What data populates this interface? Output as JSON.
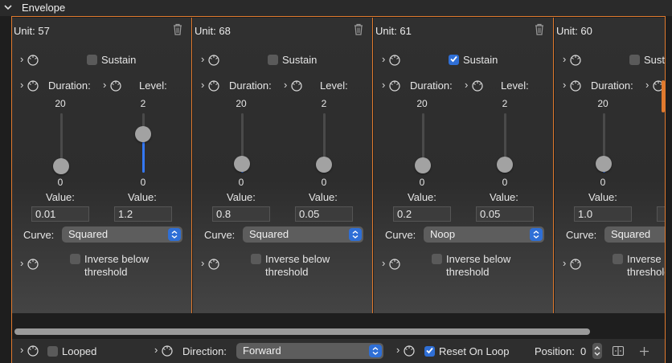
{
  "header": {
    "title": "Envelope"
  },
  "units": [
    {
      "title": "Unit: 57",
      "sustain": {
        "label": "Sustain",
        "checked": false
      },
      "duration": {
        "label": "Duration:",
        "max": "20",
        "min": "0",
        "value_label": "Value:",
        "value": "0.01",
        "level": 0.0005
      },
      "level": {
        "label": "Level:",
        "max": "2",
        "min": "0",
        "value_label": "Value:",
        "value": "1.2",
        "level": 0.6
      },
      "curve": {
        "label": "Curve:",
        "value": "Squared"
      },
      "inverse": {
        "line1": "Inverse below",
        "line2": "threshold",
        "checked": false
      }
    },
    {
      "title": "Unit: 68",
      "sustain": {
        "label": "Sustain",
        "checked": false
      },
      "duration": {
        "label": "Duration:",
        "max": "20",
        "min": "0",
        "value_label": "Value:",
        "value": "0.8",
        "level": 0.04
      },
      "level": {
        "label": "Level:",
        "max": "2",
        "min": "0",
        "value_label": "Value:",
        "value": "0.05",
        "level": 0.025
      },
      "curve": {
        "label": "Curve:",
        "value": "Squared"
      },
      "inverse": {
        "line1": "Inverse below",
        "line2": "threshold",
        "checked": false
      }
    },
    {
      "title": "Unit: 61",
      "sustain": {
        "label": "Sustain",
        "checked": true
      },
      "duration": {
        "label": "Duration:",
        "max": "20",
        "min": "0",
        "value_label": "Value:",
        "value": "0.2",
        "level": 0.01
      },
      "level": {
        "label": "Level:",
        "max": "2",
        "min": "0",
        "value_label": "Value:",
        "value": "0.05",
        "level": 0.025
      },
      "curve": {
        "label": "Curve:",
        "value": "Noop"
      },
      "inverse": {
        "line1": "Inverse below",
        "line2": "threshold",
        "checked": false
      }
    },
    {
      "title": "Unit: 60",
      "sustain": {
        "label": "Sustain",
        "checked": false
      },
      "duration": {
        "label": "Duration:",
        "max": "20",
        "min": "0",
        "value_label": "Value:",
        "value": "1.0",
        "level": 0.05
      },
      "curve": {
        "label": "Curve:",
        "value": "Squared"
      },
      "inverse": {
        "line1": "Inverse below",
        "line2": "threshold",
        "checked": false
      }
    }
  ],
  "footer": {
    "looped_label": "Looped",
    "looped_checked": false,
    "direction_label": "Direction:",
    "direction_value": "Forward",
    "reset_label": "Reset On Loop",
    "reset_checked": true,
    "position_label": "Position:",
    "position_value": "0"
  },
  "icons": {
    "collapse": "chevron-down-icon",
    "modulate": "modulation-knob-icon",
    "delete": "trash-icon",
    "popup": "updown-chevron-icon",
    "stepper": "stepper-icon",
    "split": "split-view-icon",
    "add": "plus-icon"
  },
  "colors": {
    "accent": "#3478f6",
    "border": "#e07a2e",
    "background": "#1e1e1e"
  }
}
